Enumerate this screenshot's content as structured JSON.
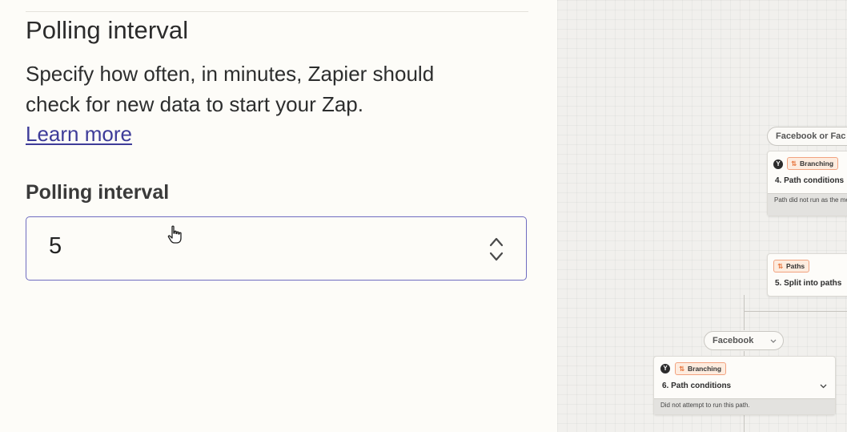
{
  "panel": {
    "section_title": "Polling interval",
    "description_line1": "Specify how often, in minutes, Zapier should",
    "description_line2": "check for new data to start your Zap.",
    "learn_more": "Learn more",
    "field_label": "Polling interval",
    "field_value": "5"
  },
  "canvas": {
    "top_pill": "Facebook or Fac",
    "node4": {
      "badge": "Branching",
      "title": "4. Path conditions",
      "note": "Path did not run as the met."
    },
    "node5": {
      "badge": "Paths",
      "title": "5. Split into paths"
    },
    "facebook_pill": "Facebook",
    "node6": {
      "badge": "Branching",
      "title": "6. Path conditions",
      "note": "Did not attempt to run this path."
    }
  },
  "colors": {
    "accent": "#6f6cc0",
    "link": "#3e3c99",
    "badge_bg": "#fdecdf",
    "badge_border": "#f2a27f"
  }
}
